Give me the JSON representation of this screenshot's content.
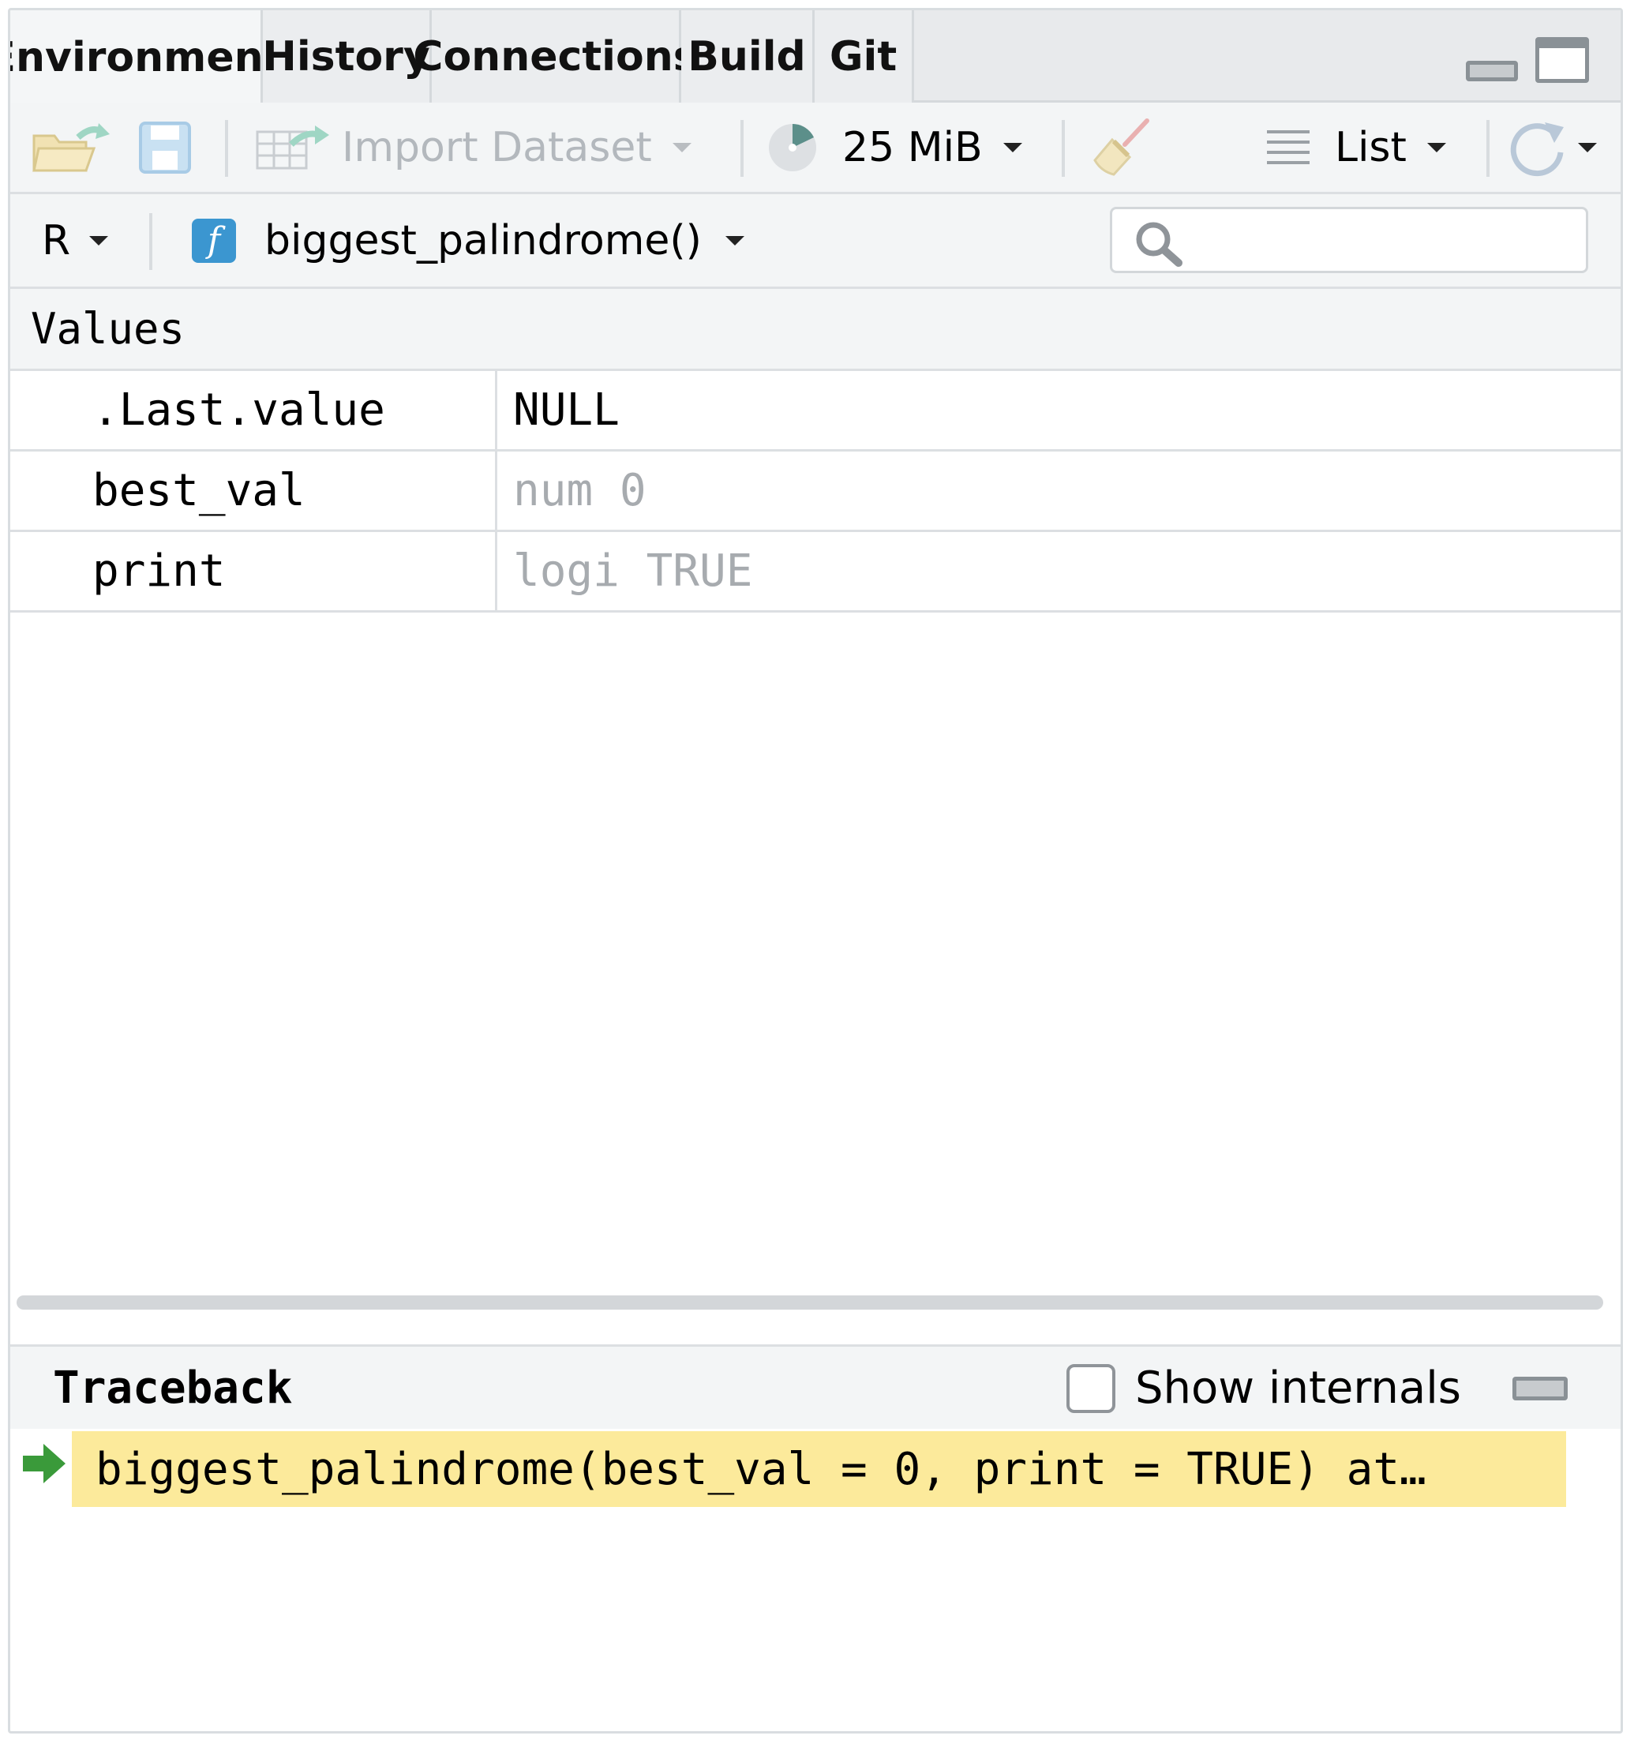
{
  "tabs": [
    {
      "label": "Environment",
      "active": true
    },
    {
      "label": "History",
      "active": false
    },
    {
      "label": "Connections",
      "active": false
    },
    {
      "label": "Build",
      "active": false
    },
    {
      "label": "Git",
      "active": false
    }
  ],
  "toolbar": {
    "import_label": "Import Dataset",
    "memory_label": "25 MiB",
    "view_mode_label": "List"
  },
  "scope": {
    "language": "R",
    "function_label": "biggest_palindrome()",
    "search_value": ""
  },
  "values": {
    "section_label": "Values",
    "rows": [
      {
        "name": ".Last.value",
        "value": "NULL",
        "muted": false
      },
      {
        "name": "best_val",
        "value": "num 0",
        "muted": true
      },
      {
        "name": "print",
        "value": "logi TRUE",
        "muted": true
      }
    ]
  },
  "traceback": {
    "title": "Traceback",
    "show_internals_label": "Show internals",
    "show_internals_checked": false,
    "frames": [
      {
        "text": "biggest_palindrome(best_val = 0, print = TRUE) at…",
        "current": true
      }
    ]
  },
  "colors": {
    "frame_highlight": "#fcea9b",
    "arrow_green": "#3a9a3a",
    "function_icon_blue": "#3b96d0"
  }
}
